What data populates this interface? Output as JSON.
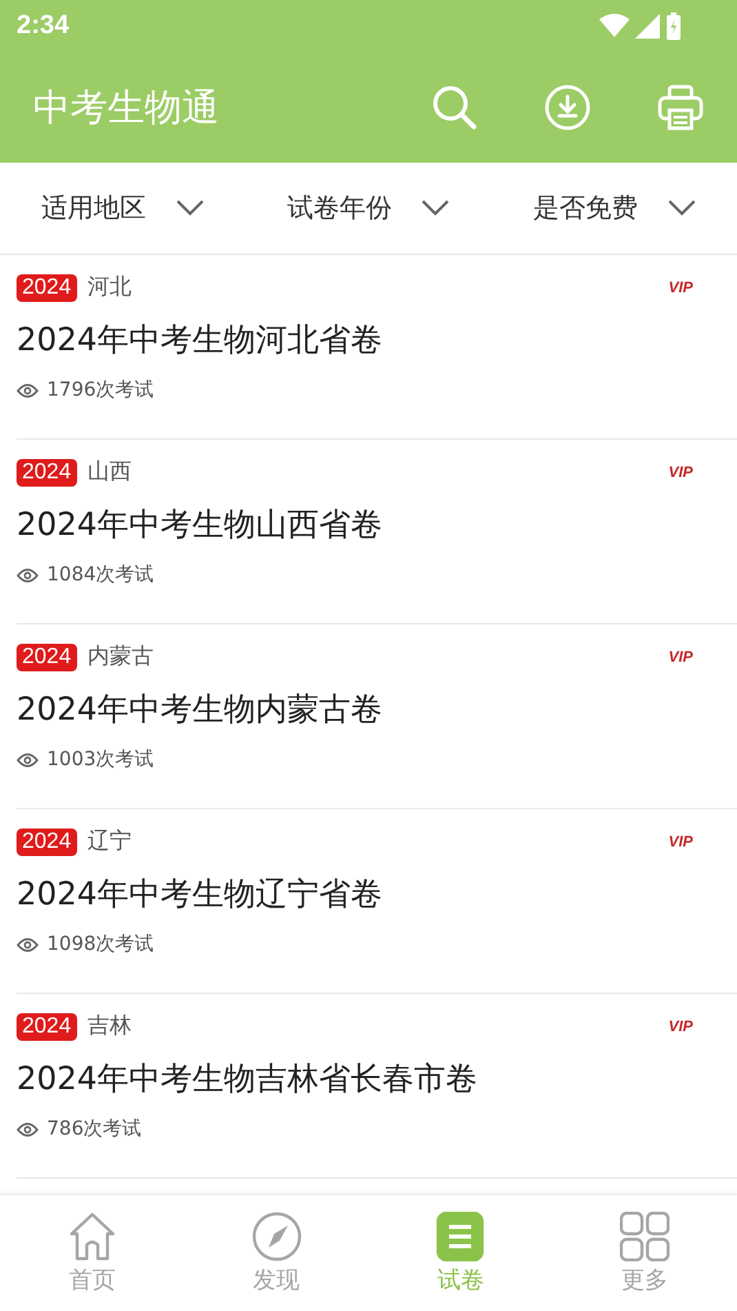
{
  "status_bar": {
    "time": "2:34"
  },
  "app_bar": {
    "title": "中考生物通"
  },
  "filters": [
    {
      "label": "适用地区"
    },
    {
      "label": "试卷年份"
    },
    {
      "label": "是否免费"
    }
  ],
  "papers": [
    {
      "year": "2024",
      "region": "河北",
      "title": "2024年中考生物河北省卷",
      "views": "1796次考试",
      "tag": "VIP"
    },
    {
      "year": "2024",
      "region": "山西",
      "title": "2024年中考生物山西省卷",
      "views": "1084次考试",
      "tag": "VIP"
    },
    {
      "year": "2024",
      "region": "内蒙古",
      "title": "2024年中考生物内蒙古卷",
      "views": "1003次考试",
      "tag": "VIP"
    },
    {
      "year": "2024",
      "region": "辽宁",
      "title": "2024年中考生物辽宁省卷",
      "views": "1098次考试",
      "tag": "VIP"
    },
    {
      "year": "2024",
      "region": "吉林",
      "title": "2024年中考生物吉林省长春市卷",
      "views": "786次考试",
      "tag": "VIP"
    }
  ],
  "tabs": [
    {
      "label": "首页",
      "kind": "home",
      "selected": false
    },
    {
      "label": "发现",
      "kind": "discover",
      "selected": false
    },
    {
      "label": "试卷",
      "kind": "papers",
      "selected": true
    },
    {
      "label": "更多",
      "kind": "more",
      "selected": false
    }
  ]
}
